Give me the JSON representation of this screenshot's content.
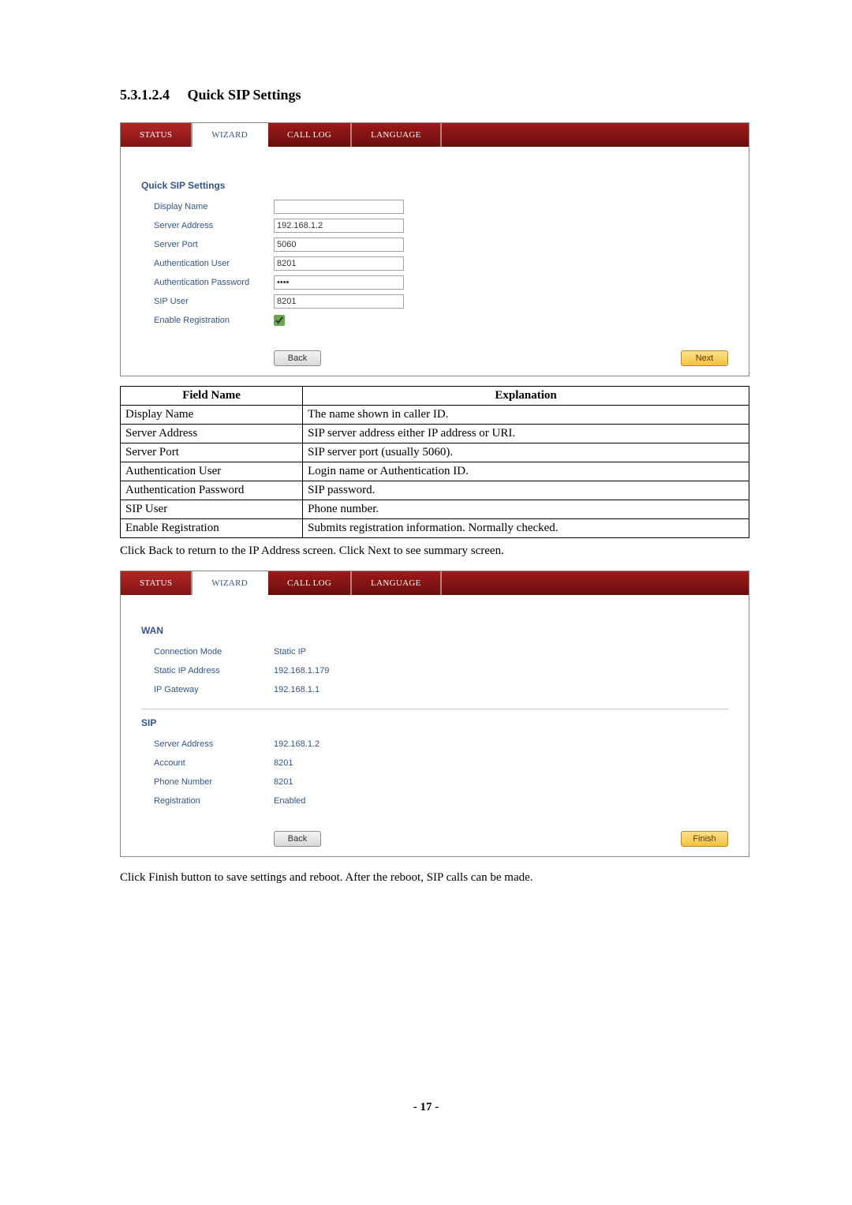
{
  "section": {
    "number": "5.3.1.2.4",
    "title": "Quick SIP Settings"
  },
  "panel1": {
    "tabs": {
      "status": "STATUS",
      "wizard": "WIZARD",
      "callLog": "CALL LOG",
      "language": "LANGUAGE"
    },
    "groupTitle": "Quick SIP Settings",
    "fields": {
      "displayName": {
        "label": "Display Name",
        "value": ""
      },
      "serverAddress": {
        "label": "Server Address",
        "value": "192.168.1.2"
      },
      "serverPort": {
        "label": "Server Port",
        "value": "5060"
      },
      "authUser": {
        "label": "Authentication User",
        "value": "8201"
      },
      "authPassword": {
        "label": "Authentication Password",
        "value": "••••"
      },
      "sipUser": {
        "label": "SIP User",
        "value": "8201"
      },
      "enableRegistration": {
        "label": "Enable Registration",
        "checked": true
      }
    },
    "buttons": {
      "back": "Back",
      "next": "Next"
    }
  },
  "fieldTable": {
    "headers": {
      "field": "Field Name",
      "explanation": "Explanation"
    },
    "rows": [
      {
        "field": "Display Name",
        "explanation": "The name shown in caller ID."
      },
      {
        "field": "Server Address",
        "explanation": "SIP server address either IP address or URI."
      },
      {
        "field": "Server Port",
        "explanation": "SIP server port (usually 5060)."
      },
      {
        "field": "Authentication User",
        "explanation": "Login name or Authentication ID."
      },
      {
        "field": "Authentication Password",
        "explanation": "SIP password."
      },
      {
        "field": "SIP User",
        "explanation": "Phone number."
      },
      {
        "field": "Enable Registration",
        "explanation": "Submits registration information.   Normally checked."
      }
    ]
  },
  "betweenText": "Click Back to return to the IP Address screen.   Click Next to see summary screen.",
  "panel2": {
    "tabs": {
      "status": "STATUS",
      "wizard": "WIZARD",
      "callLog": "CALL LOG",
      "language": "LANGUAGE"
    },
    "wan": {
      "title": "WAN",
      "rows": [
        {
          "label": "Connection Mode",
          "value": "Static IP"
        },
        {
          "label": "Static IP Address",
          "value": "192.168.1.179"
        },
        {
          "label": "IP Gateway",
          "value": "192.168.1.1"
        }
      ]
    },
    "sip": {
      "title": "SIP",
      "rows": [
        {
          "label": "Server Address",
          "value": "192.168.1.2"
        },
        {
          "label": "Account",
          "value": "8201"
        },
        {
          "label": "Phone Number",
          "value": "8201"
        },
        {
          "label": "Registration",
          "value": "Enabled"
        }
      ]
    },
    "buttons": {
      "back": "Back",
      "finish": "Finish"
    }
  },
  "afterText": "Click Finish button to save settings and reboot.   After the reboot, SIP calls can be made.",
  "pageNumber": "- 17 -"
}
